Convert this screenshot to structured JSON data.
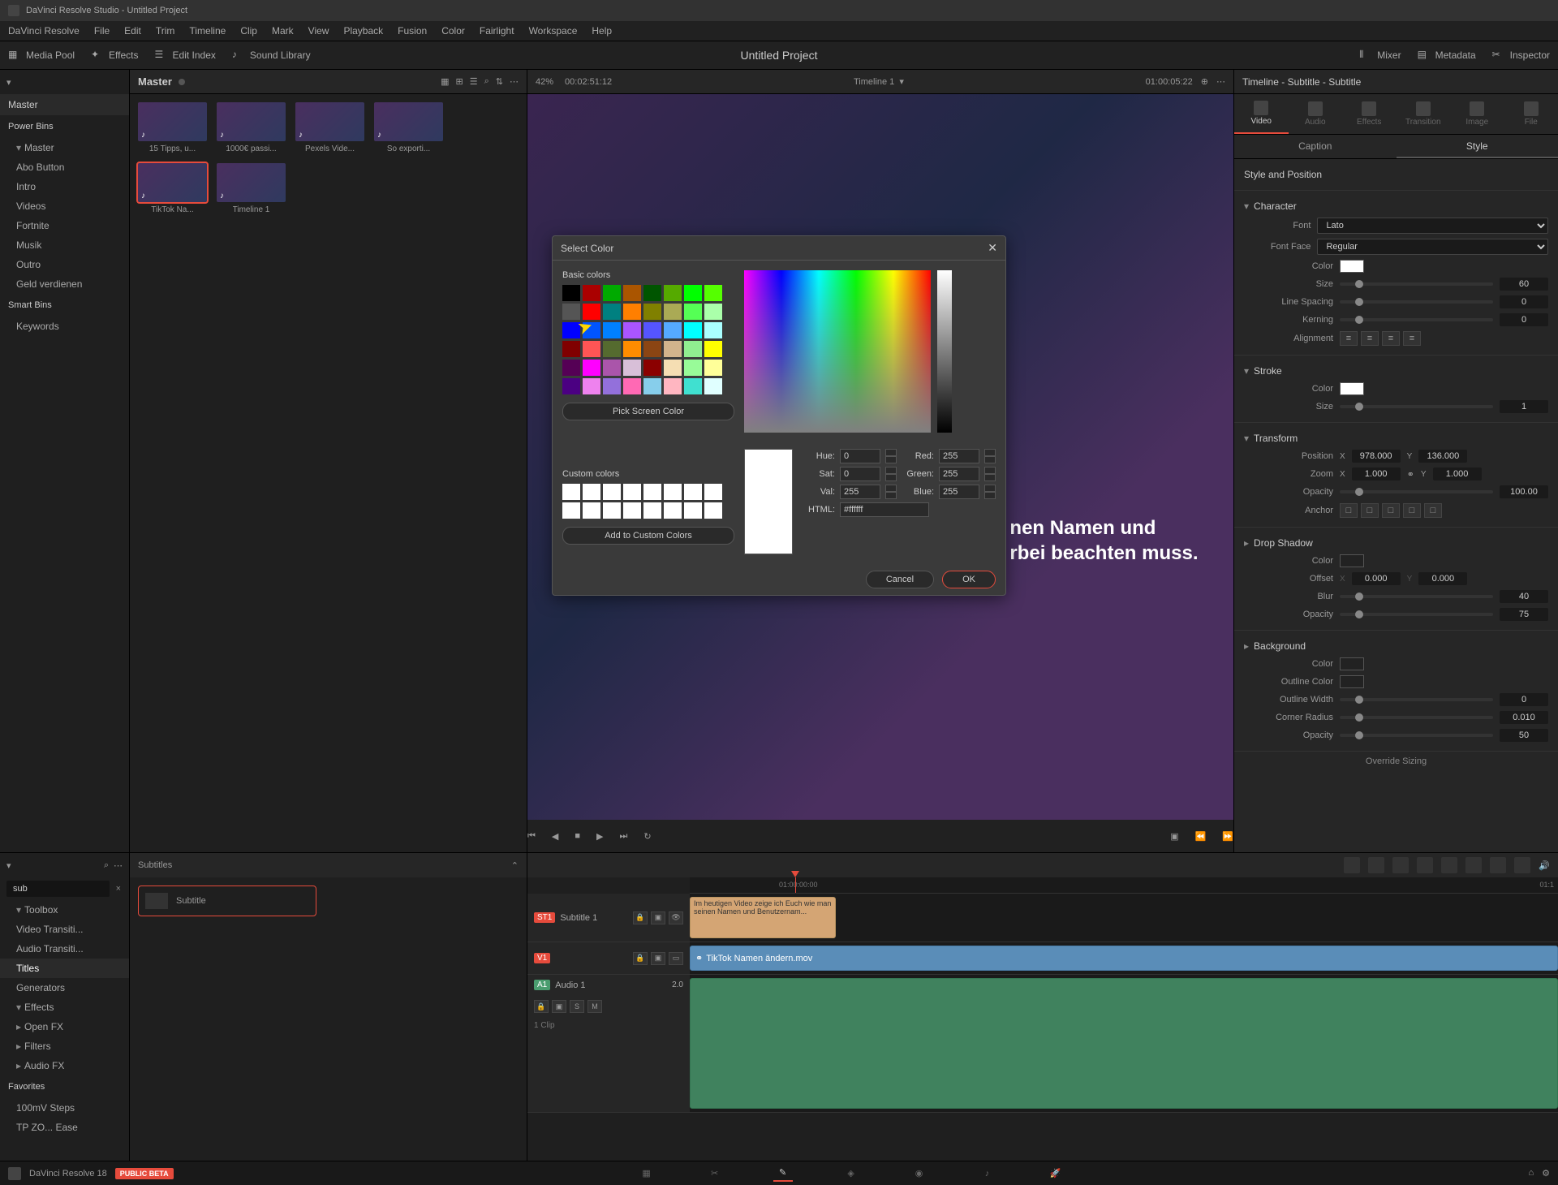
{
  "titlebar": "DaVinci Resolve Studio - Untitled Project",
  "menubar": [
    "DaVinci Resolve",
    "File",
    "Edit",
    "Trim",
    "Timeline",
    "Clip",
    "Mark",
    "View",
    "Playback",
    "Fusion",
    "Color",
    "Fairlight",
    "Workspace",
    "Help"
  ],
  "toolbar": {
    "media_pool": "Media Pool",
    "effects": "Effects",
    "edit_index": "Edit Index",
    "sound_library": "Sound Library",
    "mixer": "Mixer",
    "metadata": "Metadata",
    "inspector": "Inspector"
  },
  "project_title": "Untitled Project",
  "left": {
    "master_hdr": "Master",
    "power_bins": "Power Bins",
    "master": "Master",
    "items": [
      "Abo Button",
      "Intro",
      "Videos",
      "Fortnite",
      "Musik",
      "Outro",
      "Geld verdienen"
    ],
    "smart_bins": "Smart Bins",
    "keywords": "Keywords"
  },
  "media": {
    "title": "Master",
    "clips": [
      "15 Tipps, u...",
      "1000€ passi...",
      "Pexels Vide...",
      "So exporti...",
      "TikTok Na...",
      "Timeline 1"
    ]
  },
  "viewer": {
    "zoom": "42%",
    "tc_left": "00:02:51:12",
    "timeline_name": "Timeline 1",
    "tc_right": "01:00:05:22",
    "sub_line1": "nen Namen und",
    "sub_line2": "rbei beachten muss."
  },
  "color_dialog": {
    "title": "Select Color",
    "basic": "Basic colors",
    "pick_screen": "Pick Screen Color",
    "custom": "Custom colors",
    "add_custom": "Add to Custom Colors",
    "hue_l": "Hue:",
    "sat_l": "Sat:",
    "val_l": "Val:",
    "red_l": "Red:",
    "green_l": "Green:",
    "blue_l": "Blue:",
    "html_l": "HTML:",
    "hue": "0",
    "sat": "0",
    "val": "255",
    "red": "255",
    "green": "255",
    "blue": "255",
    "html": "#ffffff",
    "cancel": "Cancel",
    "ok": "OK",
    "basic_colors": [
      "#000000",
      "#aa0000",
      "#00aa00",
      "#aa5500",
      "#005500",
      "#55aa00",
      "#00ff00",
      "#55ff00",
      "#555555",
      "#ff0000",
      "#008080",
      "#ff7f00",
      "#808000",
      "#aaaa55",
      "#55ff55",
      "#aaffaa",
      "#0000ff",
      "#0055ff",
      "#0080ff",
      "#aa55ff",
      "#5555ff",
      "#55aaff",
      "#00ffff",
      "#aaffff",
      "#800000",
      "#ff5555",
      "#556b2f",
      "#ff8c00",
      "#8b4513",
      "#d2b48c",
      "#90ee90",
      "#ffff00",
      "#550055",
      "#ff00ff",
      "#aa55aa",
      "#d8bfd8",
      "#8b0000",
      "#f5deb3",
      "#98fb98",
      "#ffff99",
      "#4b0082",
      "#ee82ee",
      "#9370db",
      "#ff69b4",
      "#87ceeb",
      "#ffb6c1",
      "#40e0d0",
      "#e0ffff"
    ]
  },
  "inspector": {
    "header": "Timeline - Subtitle - Subtitle",
    "tabs": [
      "Video",
      "Audio",
      "Effects",
      "Transition",
      "Image",
      "File"
    ],
    "subtabs": [
      "Caption",
      "Style"
    ],
    "style_pos": "Style and Position",
    "character": "Character",
    "font_l": "Font",
    "font_v": "Lato",
    "face_l": "Font Face",
    "face_v": "Regular",
    "color_l": "Color",
    "size_l": "Size",
    "size_v": "60",
    "ls_l": "Line Spacing",
    "ls_v": "0",
    "kern_l": "Kerning",
    "kern_v": "0",
    "align_l": "Alignment",
    "stroke": "Stroke",
    "stroke_color_l": "Color",
    "stroke_size_l": "Size",
    "stroke_size_v": "1",
    "transform": "Transform",
    "pos_l": "Position",
    "pos_x": "978.000",
    "pos_y": "136.000",
    "zoom_l": "Zoom",
    "zoom_x": "1.000",
    "zoom_y": "1.000",
    "opacity_l": "Opacity",
    "opacity_v": "100.00",
    "anchor_l": "Anchor",
    "drop": "Drop Shadow",
    "ds_color_l": "Color",
    "ds_off_l": "Offset",
    "ds_off_x": "0.000",
    "ds_off_y": "0.000",
    "ds_blur_l": "Blur",
    "ds_blur_v": "40",
    "ds_op_l": "Opacity",
    "ds_op_v": "75",
    "bg": "Background",
    "bg_color_l": "Color",
    "bg_oc_l": "Outline Color",
    "bg_ow_l": "Outline Width",
    "bg_ow_v": "0",
    "bg_cr_l": "Corner Radius",
    "bg_cr_v": "0.010",
    "bg_op_l": "Opacity",
    "bg_op_v": "50",
    "override": "Override Sizing"
  },
  "effects_browser": {
    "search": "sub",
    "toolbox": "Toolbox",
    "items": [
      "Video Transiti...",
      "Audio Transiti...",
      "Titles",
      "Generators"
    ],
    "effects": "Effects",
    "filters": "Filters",
    "openfx": "Open FX",
    "audiofx": "Audio FX",
    "favorites": "Favorites",
    "fav_items": [
      "100mV Steps",
      "TP ZO... Ease"
    ],
    "panel_title": "Subtitles",
    "card": "Subtitle"
  },
  "timeline": {
    "ruler": [
      "01:00:00:00",
      "01:1"
    ],
    "st1": "ST1",
    "st1_name": "Subtitle 1",
    "sub_text": "Im heutigen Video zeige ich Euch wie man seinen Namen und Benutzernam...",
    "v1": "V1",
    "v1_clip": "TikTok Namen ändern.mov",
    "a1": "A1",
    "a1_name": "Audio 1",
    "a1_ch": "2.0",
    "clips_count": "1 Clip"
  },
  "status": {
    "app": "DaVinci Resolve 18",
    "beta": "PUBLIC BETA"
  }
}
